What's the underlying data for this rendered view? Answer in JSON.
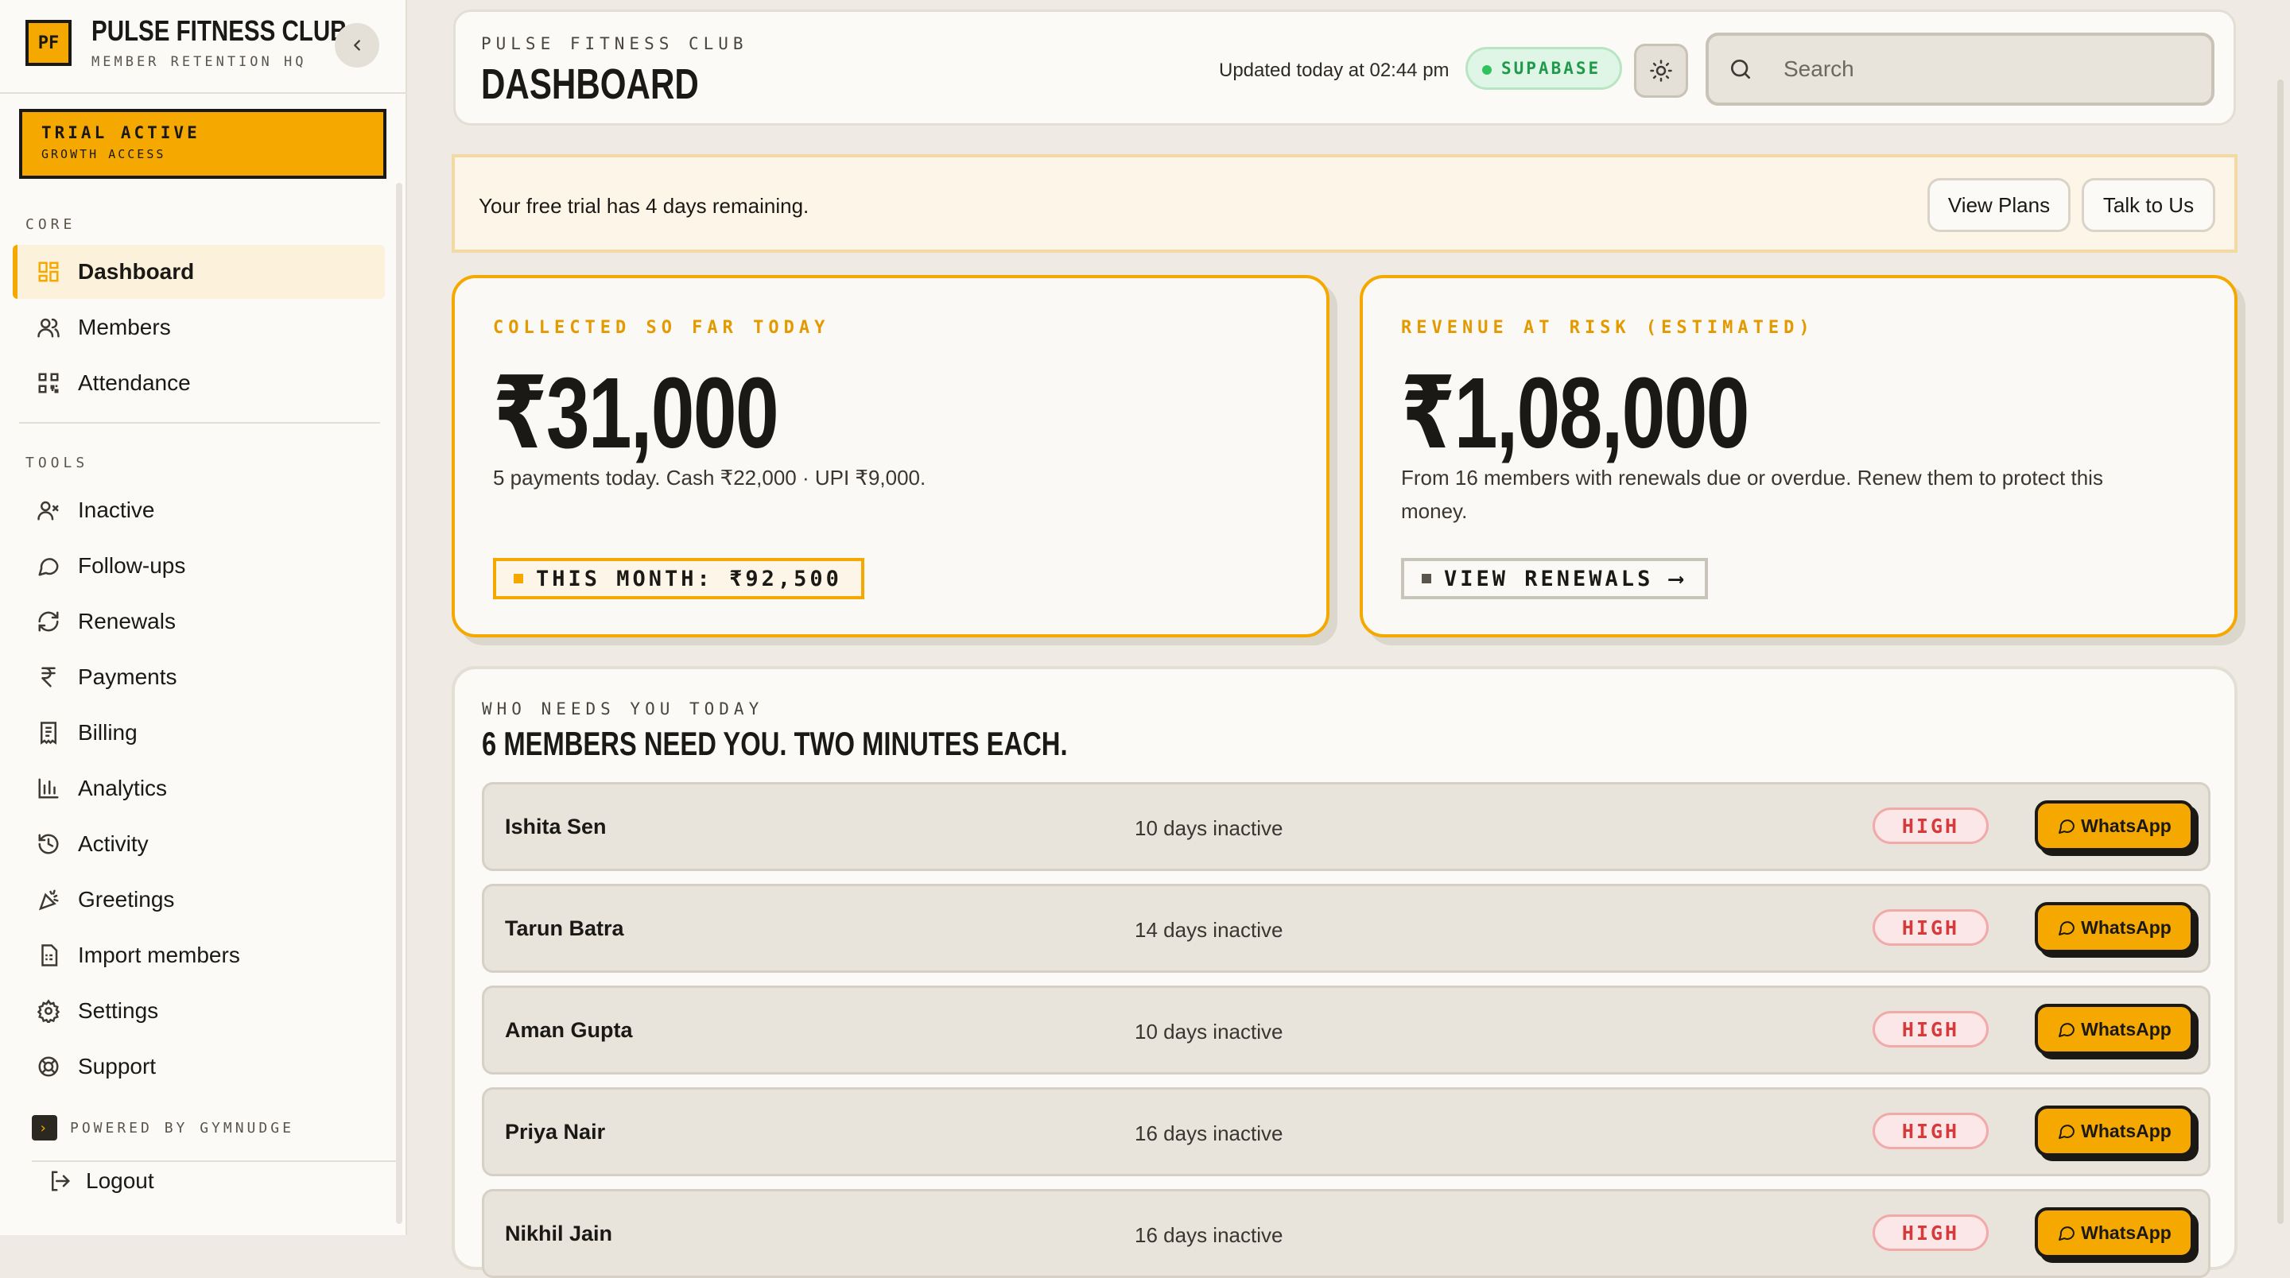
{
  "brand": {
    "logo": "PF",
    "name": "PULSE FITNESS CLUB",
    "subtitle": "MEMBER RETENTION HQ"
  },
  "trial": {
    "title": "TRIAL ACTIVE",
    "subtitle": "GROWTH ACCESS"
  },
  "sidebar": {
    "core_label": "CORE",
    "core_items": [
      {
        "label": "Dashboard",
        "icon": "dashboard-icon",
        "active": true
      },
      {
        "label": "Members",
        "icon": "users-icon"
      },
      {
        "label": "Attendance",
        "icon": "qr-icon"
      }
    ],
    "tools_label": "TOOLS",
    "tools_items": [
      {
        "label": "Inactive",
        "icon": "user-x-icon"
      },
      {
        "label": "Follow-ups",
        "icon": "chat-icon"
      },
      {
        "label": "Renewals",
        "icon": "refresh-icon"
      },
      {
        "label": "Payments",
        "icon": "rupee-icon"
      },
      {
        "label": "Billing",
        "icon": "receipt-icon"
      },
      {
        "label": "Analytics",
        "icon": "bar-chart-icon"
      },
      {
        "label": "Activity",
        "icon": "history-icon"
      },
      {
        "label": "Greetings",
        "icon": "party-icon"
      },
      {
        "label": "Import members",
        "icon": "file-icon"
      },
      {
        "label": "Settings",
        "icon": "gear-icon"
      },
      {
        "label": "Support",
        "icon": "lifebuoy-icon"
      }
    ],
    "powered_by": "POWERED BY GYMNUDGE",
    "logout": "Logout"
  },
  "header": {
    "club": "PULSE FITNESS CLUB",
    "title": "DASHBOARD",
    "updated": "Updated today at 02:44 pm",
    "badge": "SUPABASE",
    "search_placeholder": "Search"
  },
  "banner": {
    "text": "Your free trial has 4 days remaining.",
    "view_plans": "View Plans",
    "talk_to_us": "Talk to Us"
  },
  "cards": {
    "collected": {
      "label": "COLLECTED SO FAR TODAY",
      "value": "₹31,000",
      "desc": "5 payments today. Cash ₹22,000 · UPI ₹9,000.",
      "tag": "THIS MONTH: ₹92,500"
    },
    "risk": {
      "label": "REVENUE AT RISK (ESTIMATED)",
      "value": "₹1,08,000",
      "desc": "From 16 members with renewals due or overdue. Renew them to protect this money.",
      "tag": "VIEW RENEWALS ⟶"
    }
  },
  "members_panel": {
    "label": "WHO NEEDS YOU TODAY",
    "title": "6 MEMBERS NEED YOU. TWO MINUTES EACH.",
    "action_label": "WhatsApp",
    "rows": [
      {
        "name": "Ishita Sen",
        "days": "10 days inactive",
        "priority": "HIGH"
      },
      {
        "name": "Tarun Batra",
        "days": "14 days inactive",
        "priority": "HIGH"
      },
      {
        "name": "Aman Gupta",
        "days": "10 days inactive",
        "priority": "HIGH"
      },
      {
        "name": "Priya Nair",
        "days": "16 days inactive",
        "priority": "HIGH"
      },
      {
        "name": "Nikhil Jain",
        "days": "16 days inactive",
        "priority": "HIGH"
      }
    ]
  },
  "colors": {
    "accent": "#f5a900",
    "background": "#efebe4",
    "danger": "#d63a3a",
    "success": "#1f9a4a"
  }
}
